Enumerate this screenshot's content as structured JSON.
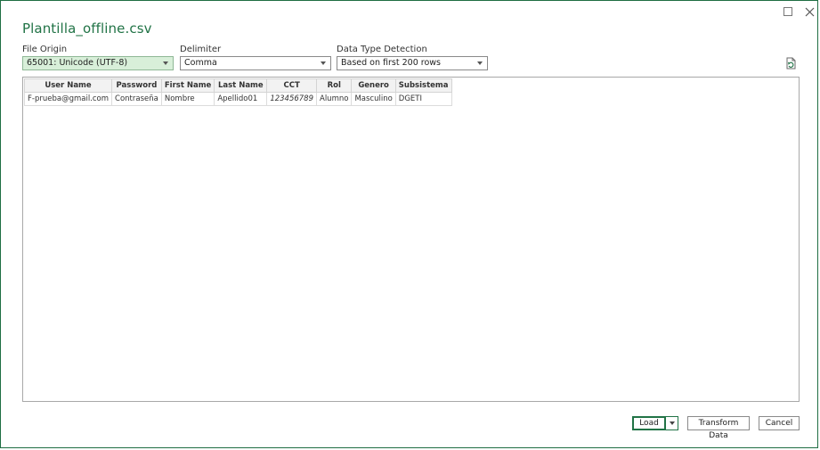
{
  "window": {
    "title": "Plantilla_offline.csv",
    "maximize_icon": "maximize-icon",
    "close_icon": "close-icon"
  },
  "options": {
    "file_origin": {
      "label": "File Origin",
      "value": "65001: Unicode (UTF-8)"
    },
    "delimiter": {
      "label": "Delimiter",
      "value": "Comma"
    },
    "data_type_detection": {
      "label": "Data Type Detection",
      "value": "Based on first 200 rows"
    },
    "refresh_icon": "refresh-icon"
  },
  "table": {
    "columns": [
      "User Name",
      "Password",
      "First Name",
      "Last Name",
      "CCT",
      "Rol",
      "Genero",
      "Subsistema"
    ],
    "rows": [
      [
        "F-prueba@gmail.com",
        "Contraseña",
        "Nombre",
        "Apellido01",
        "123456789",
        "Alumno",
        "Masculino",
        "DGETI"
      ]
    ]
  },
  "buttons": {
    "load": "Load",
    "transform": "Transform Data",
    "cancel": "Cancel"
  },
  "colors": {
    "accent": "#217346",
    "selected_bg": "#d8efd9",
    "border": "#8a8a8a"
  }
}
